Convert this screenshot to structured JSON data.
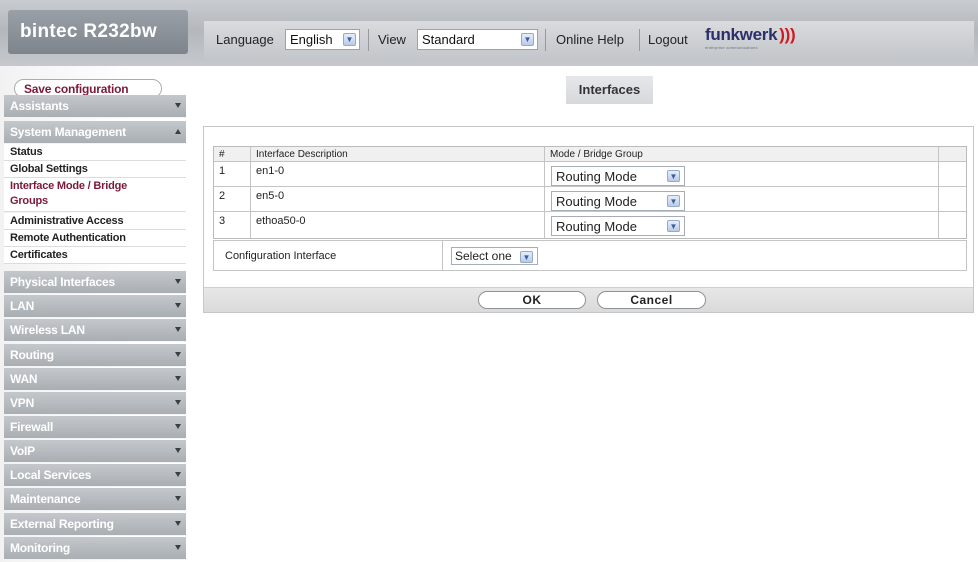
{
  "header": {
    "brand": "bintec  R232bw",
    "language_label": "Language",
    "language_value": "English",
    "view_label": "View",
    "view_value": "Standard",
    "online_help": "Online Help",
    "logout": "Logout",
    "logo_text": "funkwerk",
    "logo_tagline": "enterprise communications",
    "logo_waves": ")))"
  },
  "sidebar": {
    "save_label": "Save configuration",
    "sections": {
      "assistants": "Assistants",
      "system_management": "System Management",
      "physical_interfaces": "Physical Interfaces",
      "lan": "LAN",
      "wireless_lan": "Wireless LAN",
      "routing": "Routing",
      "wan": "WAN",
      "vpn": "VPN",
      "firewall": "Firewall",
      "voip": "VoIP",
      "local_services": "Local Services",
      "maintenance": "Maintenance",
      "external_reporting": "External Reporting",
      "monitoring": "Monitoring"
    },
    "sub_items": {
      "status": "Status",
      "global_settings": "Global Settings",
      "interface_mode_1": "Interface Mode / Bridge",
      "interface_mode_2": "Groups",
      "administrative_access": "Administrative Access",
      "remote_authentication": "Remote Authentication",
      "certificates": "Certificates"
    }
  },
  "main": {
    "title": "Interfaces",
    "table": {
      "headers": [
        "#",
        "Interface Description",
        "Mode / Bridge Group"
      ],
      "rows": [
        {
          "num": "1",
          "desc": "en1-0",
          "mode": "Routing Mode"
        },
        {
          "num": "2",
          "desc": "en5-0",
          "mode": "Routing Mode"
        },
        {
          "num": "3",
          "desc": "ethoa50-0",
          "mode": "Routing Mode"
        }
      ]
    },
    "config_interface_label": "Configuration Interface",
    "config_interface_value": "Select one",
    "ok_label": "OK",
    "cancel_label": "Cancel"
  },
  "icons": {
    "dropdown": "chevron-down-icon",
    "menu_collapsed": "caret-down-icon",
    "menu_expanded": "caret-up-icon"
  },
  "colors": {
    "accent_active": "#7a1a3a",
    "nav_bg": "#a9aeb3",
    "logo": "#2b2f6a",
    "logo_waves": "#d01820"
  }
}
